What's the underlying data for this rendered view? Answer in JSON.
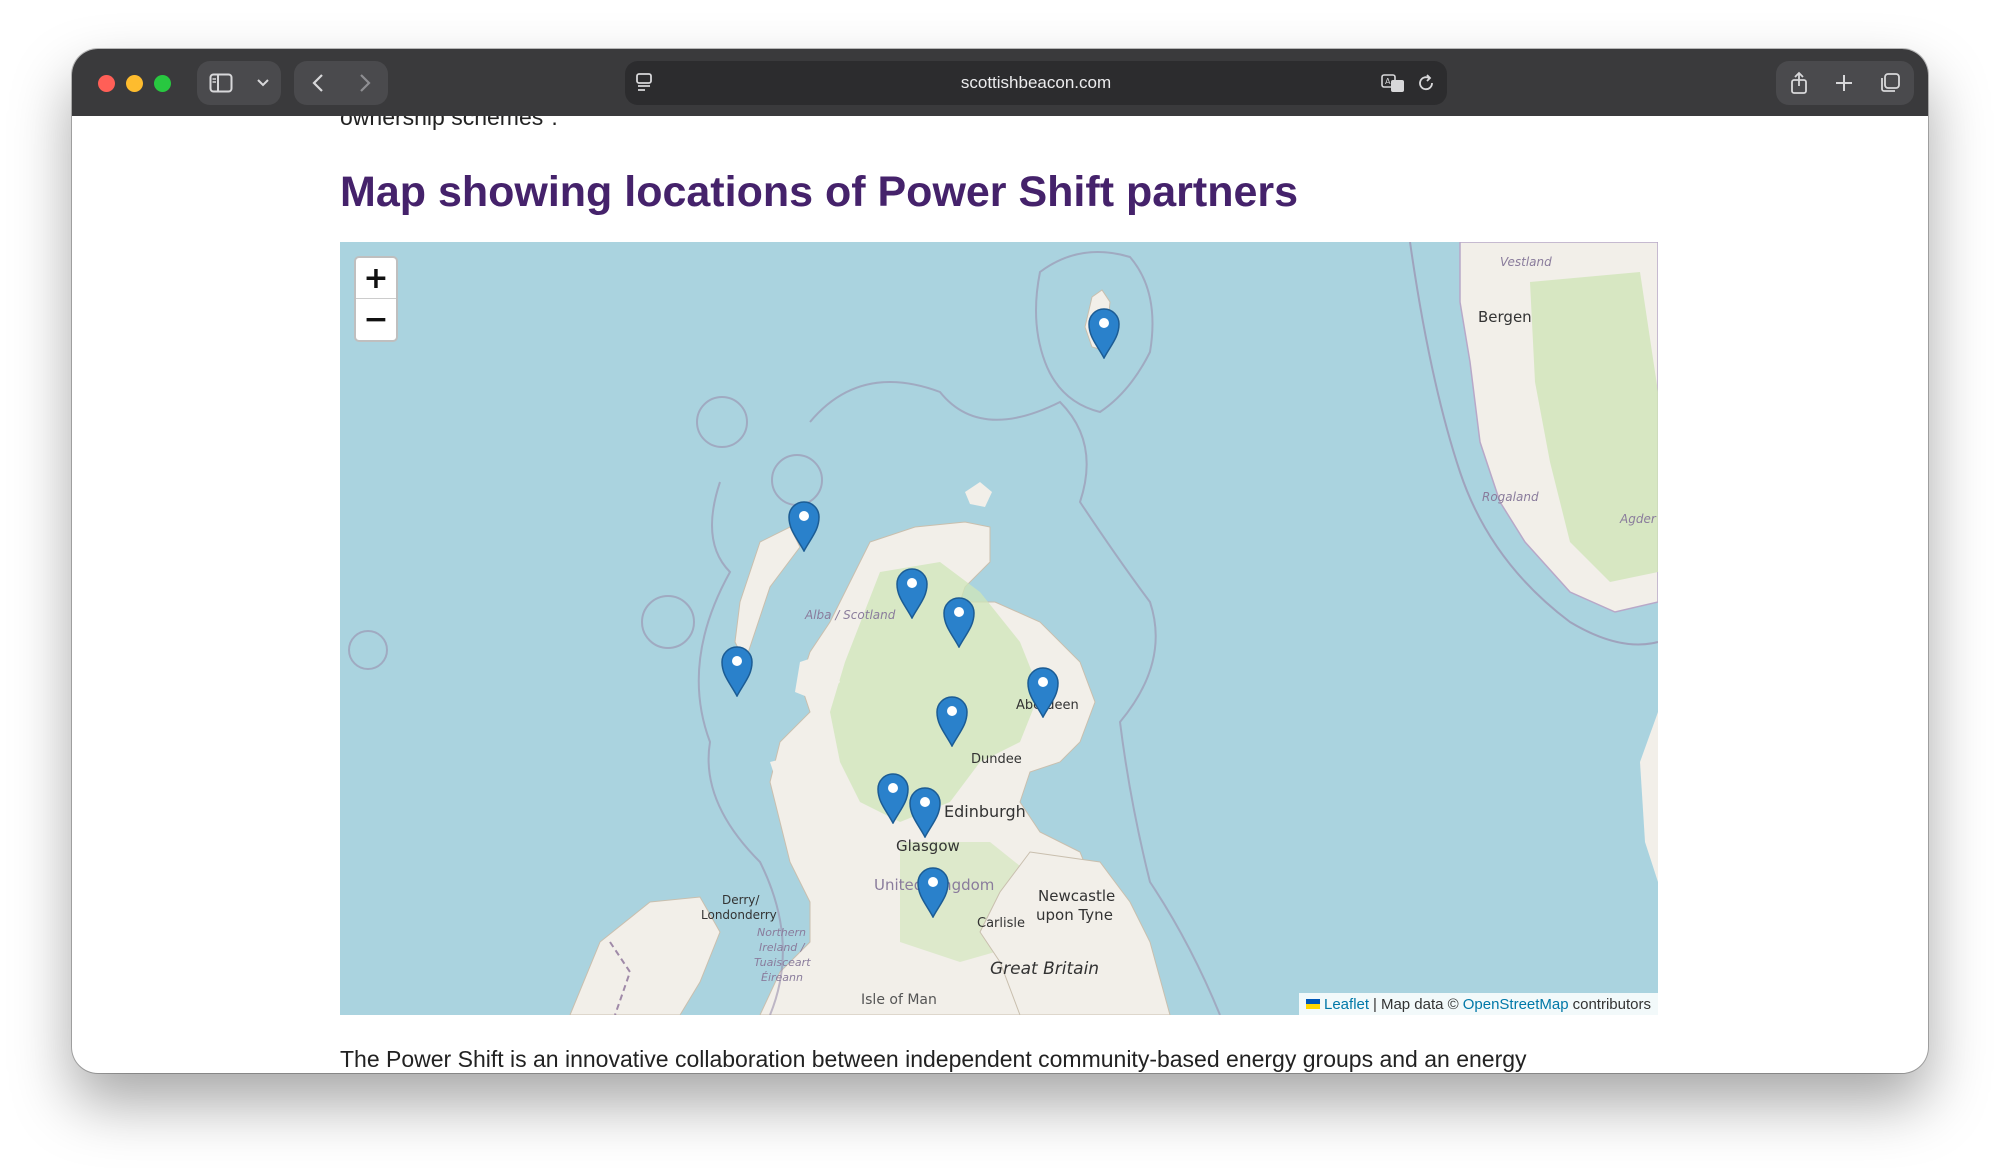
{
  "browser": {
    "url": "scottishbeacon.com",
    "icons": [
      "sidebar-icon",
      "chevron-down-icon",
      "back-icon",
      "forward-icon",
      "page-settings-icon",
      "translate-icon",
      "reload-icon",
      "share-icon",
      "new-tab-icon",
      "tabs-overview-icon"
    ]
  },
  "page": {
    "cut_off_text_top": "ownership schemes\".",
    "heading": "Map showing locations of Power Shift partners",
    "cut_off_text_bottom": "The Power Shift is an innovative collaboration between independent community-based energy groups and an energy"
  },
  "map": {
    "zoom_in": "+",
    "zoom_out": "−",
    "labels": {
      "vestland": "Vestland",
      "bergen": "Bergen",
      "rogaland": "Rogaland",
      "agder": "Agder",
      "alba": "Alba / Scotland",
      "aberdeen": "Aberdeen",
      "dundee": "Dundee",
      "edinburgh": "Edinburgh",
      "glasgow": "Glasgow",
      "united_kingdom": "United Kingdom",
      "newcastle_1": "Newcastle",
      "newcastle_2": "upon Tyne",
      "carlisle": "Carlisle",
      "derry_1": "Derry/",
      "derry_2": "Londonderry",
      "ni_1": "Northern",
      "ni_2": "Ireland /",
      "ni_3": "Tuaisceart",
      "ni_4": "Éireann",
      "great_britain": "Great Britain",
      "isle_of_man": "Isle of Man"
    },
    "marker_count": 10,
    "attribution": {
      "leaflet": "Leaflet",
      "sep": "|",
      "map_data": "Map data ©",
      "osm": "OpenStreetMap",
      "contributors": "contributors"
    },
    "colors": {
      "sea": "#aad3df",
      "land": "#f2efe9",
      "green": "#cfe5b8",
      "marker": "#2a81cb",
      "boundary": "#9a8fae",
      "heading": "#45226b"
    }
  }
}
